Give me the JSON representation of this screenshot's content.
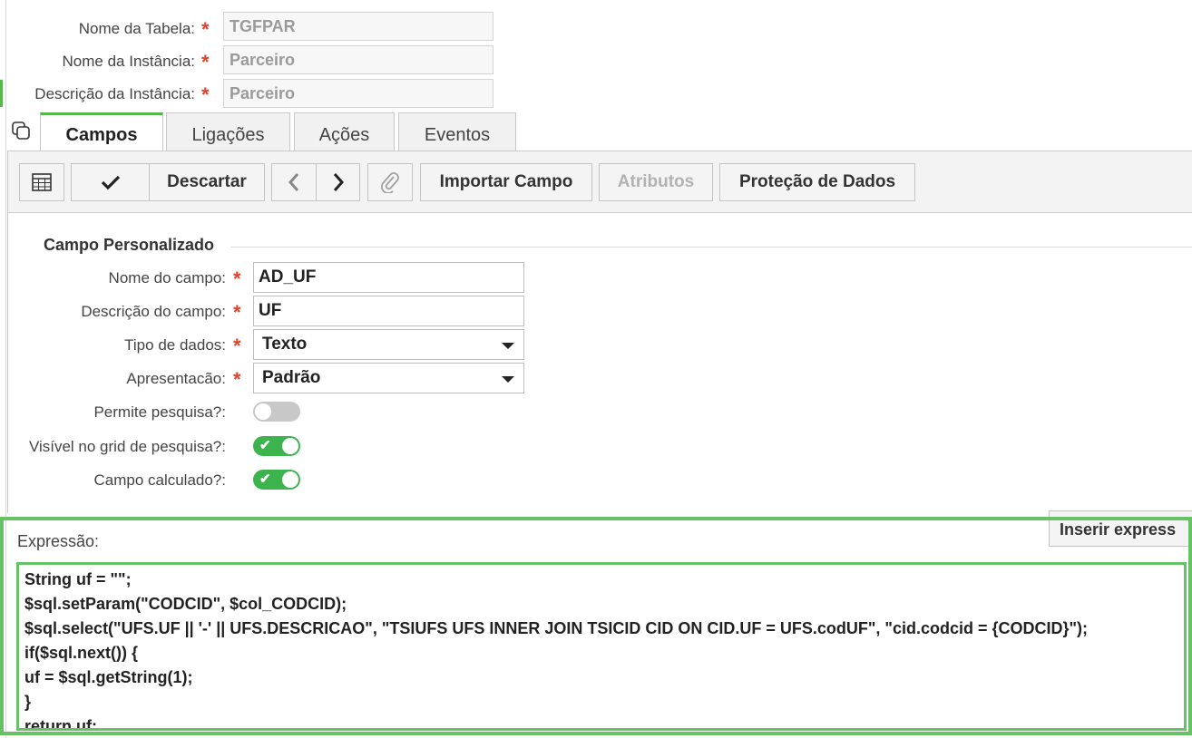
{
  "header": {
    "fields": [
      {
        "label": "Nome da Tabela:",
        "value": "TGFPAR"
      },
      {
        "label": "Nome da Instância:",
        "value": "Parceiro"
      },
      {
        "label": "Descrição da Instância:",
        "value": "Parceiro"
      }
    ],
    "required_mark": "*"
  },
  "tabs": [
    {
      "label": "Campos",
      "active": true
    },
    {
      "label": "Ligações",
      "active": false
    },
    {
      "label": "Ações",
      "active": false
    },
    {
      "label": "Eventos",
      "active": false
    }
  ],
  "toolbar": {
    "grid_icon": "grid-icon",
    "save_icon": "check-icon",
    "discard_label": "Descartar",
    "prev_icon": "chevron-left-icon",
    "next_icon": "chevron-right-icon",
    "attach_icon": "paperclip-icon",
    "import_label": "Importar Campo",
    "attributes_label": "Atributos",
    "protection_label": "Proteção de Dados"
  },
  "form": {
    "section_title": "Campo Personalizado",
    "field_name_label": "Nome do campo:",
    "field_name_value": "AD_UF",
    "field_desc_label": "Descrição do campo:",
    "field_desc_value": "UF",
    "data_type_label": "Tipo de dados:",
    "data_type_value": "Texto",
    "presentation_label": "Apresentacão:",
    "presentation_value": "Padrão",
    "searchable_label": "Permite pesquisa?:",
    "searchable_on": false,
    "visible_grid_label": "Visível no grid de pesquisa?:",
    "visible_grid_on": true,
    "calculated_label": "Campo calculado?:",
    "calculated_on": true,
    "check_glyph": "✔"
  },
  "expression": {
    "label": "Expressão:",
    "insert_button": "Inserir express",
    "code_lines": [
      "String uf = \"\";",
      "$sql.setParam(\"CODCID\", $col_CODCID);",
      "$sql.select(\"UFS.UF || '-' || UFS.DESCRICAO\", \"TSIUFS UFS INNER JOIN TSICID CID ON CID.UF = UFS.codUF\", \"cid.codcid = {CODCID}\");",
      "if($sql.next()) {",
      "uf = $sql.getString(1);",
      "}",
      "return uf;"
    ]
  },
  "colors": {
    "accent_green": "#56b84a",
    "toggle_on": "#3db34d",
    "required_red": "#e0432b",
    "highlight_border": "#67c266"
  }
}
